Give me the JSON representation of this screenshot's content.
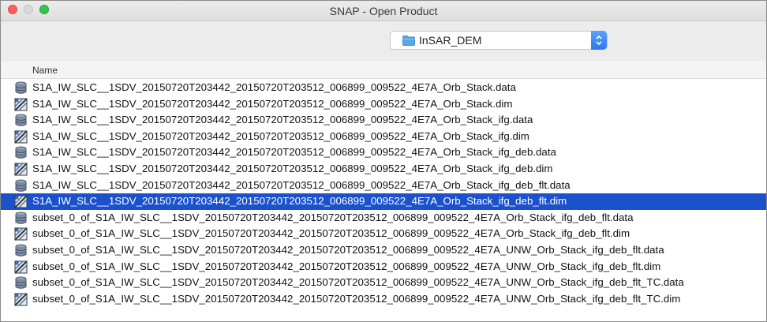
{
  "window": {
    "title": "SNAP - Open Product"
  },
  "location": {
    "folder": "InSAR_DEM",
    "icon": "folder-icon"
  },
  "list": {
    "column_header": "Name",
    "selected_index": 7,
    "items": [
      {
        "name": "S1A_IW_SLC__1SDV_20150720T203442_20150720T203512_006899_009522_4E7A_Orb_Stack.data",
        "icon": "database-icon"
      },
      {
        "name": "S1A_IW_SLC__1SDV_20150720T203442_20150720T203512_006899_009522_4E7A_Orb_Stack.dim",
        "icon": "product-icon"
      },
      {
        "name": "S1A_IW_SLC__1SDV_20150720T203442_20150720T203512_006899_009522_4E7A_Orb_Stack_ifg.data",
        "icon": "database-icon"
      },
      {
        "name": "S1A_IW_SLC__1SDV_20150720T203442_20150720T203512_006899_009522_4E7A_Orb_Stack_ifg.dim",
        "icon": "product-icon"
      },
      {
        "name": "S1A_IW_SLC__1SDV_20150720T203442_20150720T203512_006899_009522_4E7A_Orb_Stack_ifg_deb.data",
        "icon": "database-icon"
      },
      {
        "name": "S1A_IW_SLC__1SDV_20150720T203442_20150720T203512_006899_009522_4E7A_Orb_Stack_ifg_deb.dim",
        "icon": "product-icon"
      },
      {
        "name": "S1A_IW_SLC__1SDV_20150720T203442_20150720T203512_006899_009522_4E7A_Orb_Stack_ifg_deb_flt.data",
        "icon": "database-icon"
      },
      {
        "name": "S1A_IW_SLC__1SDV_20150720T203442_20150720T203512_006899_009522_4E7A_Orb_Stack_ifg_deb_flt.dim",
        "icon": "product-icon"
      },
      {
        "name": "subset_0_of_S1A_IW_SLC__1SDV_20150720T203442_20150720T203512_006899_009522_4E7A_Orb_Stack_ifg_deb_flt.data",
        "icon": "database-icon"
      },
      {
        "name": "subset_0_of_S1A_IW_SLC__1SDV_20150720T203442_20150720T203512_006899_009522_4E7A_Orb_Stack_ifg_deb_flt.dim",
        "icon": "product-icon"
      },
      {
        "name": "subset_0_of_S1A_IW_SLC__1SDV_20150720T203442_20150720T203512_006899_009522_4E7A_UNW_Orb_Stack_ifg_deb_flt.data",
        "icon": "database-icon"
      },
      {
        "name": "subset_0_of_S1A_IW_SLC__1SDV_20150720T203442_20150720T203512_006899_009522_4E7A_UNW_Orb_Stack_ifg_deb_flt.dim",
        "icon": "product-icon"
      },
      {
        "name": "subset_0_of_S1A_IW_SLC__1SDV_20150720T203442_20150720T203512_006899_009522_4E7A_UNW_Orb_Stack_ifg_deb_flt_TC.data",
        "icon": "database-icon"
      },
      {
        "name": "subset_0_of_S1A_IW_SLC__1SDV_20150720T203442_20150720T203512_006899_009522_4E7A_UNW_Orb_Stack_ifg_deb_flt_TC.dim",
        "icon": "product-icon"
      }
    ]
  },
  "colors": {
    "selection": "#1b52cc",
    "accent": "#3c87f0",
    "folder": "#5aa6e6"
  }
}
